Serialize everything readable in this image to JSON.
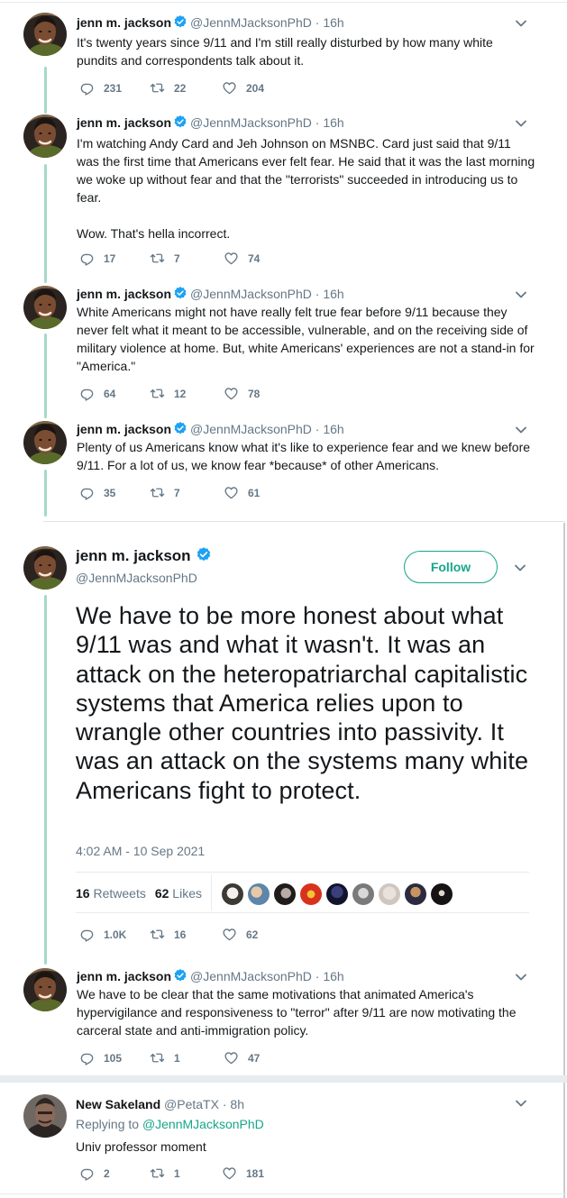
{
  "colors": {
    "accent": "#17a689",
    "thread_line": "#a5d9c8",
    "muted": "#657786",
    "text": "#14171a",
    "verified": "#1da1f2"
  },
  "tweets": [
    {
      "name": "jenn m. jackson",
      "handle": "@JennMJacksonPhD",
      "time": "16h",
      "text": "It's twenty years since 9/11 and I'm still really disturbed by how many white pundits and correspondents talk about it.",
      "replies": "231",
      "retweets": "22",
      "likes": "204"
    },
    {
      "name": "jenn m. jackson",
      "handle": "@JennMJacksonPhD",
      "time": "16h",
      "text": "I'm watching Andy Card and Jeh Johnson on MSNBC. Card just said that 9/11 was the first time that Americans ever felt fear. He said that it was the last morning we woke up without fear and that the \"terrorists\" succeeded in introducing us to fear.\n\nWow. That's hella incorrect.",
      "replies": "17",
      "retweets": "7",
      "likes": "74"
    },
    {
      "name": "jenn m. jackson",
      "handle": "@JennMJacksonPhD",
      "time": "16h",
      "text": "White Americans might not have really felt true fear before 9/11 because they never felt what it meant to be accessible, vulnerable, and on the receiving side of military violence at home. But, white Americans' experiences are not a stand-in for \"America.\"",
      "replies": "64",
      "retweets": "12",
      "likes": "78"
    },
    {
      "name": "jenn m. jackson",
      "handle": "@JennMJacksonPhD",
      "time": "16h",
      "text": "Plenty of us Americans know what it's like to experience fear and we knew before 9/11. For a lot of us, we know fear *because* of other Americans.",
      "replies": "35",
      "retweets": "7",
      "likes": "61"
    }
  ],
  "main_tweet": {
    "name": "jenn m. jackson",
    "handle": "@JennMJacksonPhD",
    "follow_label": "Follow",
    "text": "We have to be more honest about what 9/11 was and what it wasn't. It was an attack on the heteropatriarchal capitalistic systems that America relies upon to wrangle other countries into passivity. It was an attack on the systems many white Americans fight to protect.",
    "timestamp": "4:02 AM - 10 Sep 2021",
    "retweets_count": "16",
    "retweets_label": "Retweets",
    "likes_count": "62",
    "likes_label": "Likes",
    "replies": "1.0K",
    "retweets": "16",
    "likes": "62"
  },
  "follow_up": {
    "name": "jenn m. jackson",
    "handle": "@JennMJacksonPhD",
    "time": "16h",
    "text": "We have to be clear that the same motivations that animated America's hypervigilance and responsiveness to \"terror\" after 9/11 are now motivating the carceral state and anti-immigration policy.",
    "replies": "105",
    "retweets": "1",
    "likes": "47"
  },
  "reply": {
    "name": "New Sakeland",
    "handle": "@PetaTX",
    "time": "8h",
    "replying_prefix": "Replying to",
    "replying_to": "@JennMJacksonPhD",
    "text": "Univ professor moment",
    "replies": "2",
    "retweets": "1",
    "likes": "181"
  },
  "separator": "·"
}
